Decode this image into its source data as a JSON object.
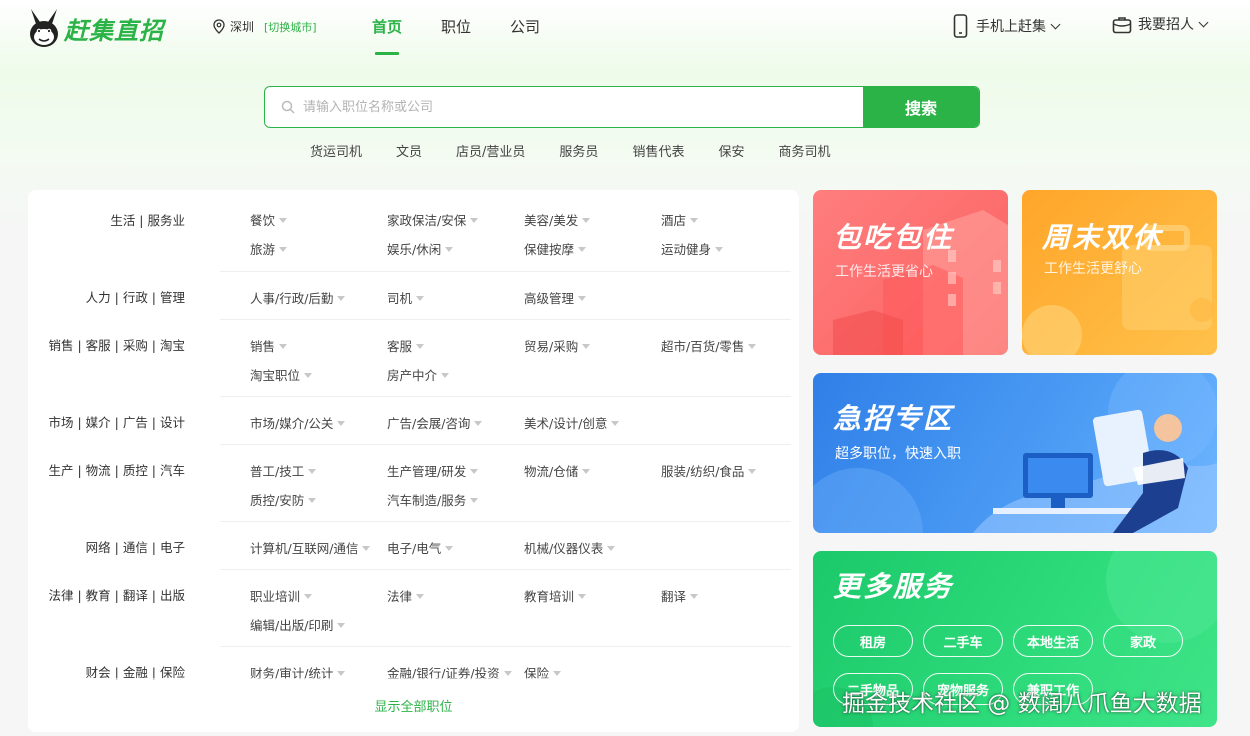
{
  "header": {
    "logo_text": "赶集直招",
    "city": "深圳",
    "switch_city": "[切换城市]",
    "nav": [
      {
        "label": "首页",
        "active": true
      },
      {
        "label": "职位",
        "active": false
      },
      {
        "label": "公司",
        "active": false
      }
    ],
    "mobile_label": "手机上赶集",
    "recruit_label": "我要招人"
  },
  "search": {
    "placeholder": "请输入职位名称或公司",
    "button_label": "搜索",
    "hot_keywords": [
      "货运司机",
      "文员",
      "店员/营业员",
      "服务员",
      "销售代表",
      "保安",
      "商务司机"
    ]
  },
  "categories": [
    {
      "name": "生活 | 服务业",
      "items": [
        "餐饮",
        "家政保洁/安保",
        "美容/美发",
        "酒店",
        "旅游",
        "娱乐/休闲",
        "保健按摩",
        "运动健身"
      ]
    },
    {
      "name": "人力 | 行政 | 管理",
      "items": [
        "人事/行政/后勤",
        "司机",
        "高级管理"
      ]
    },
    {
      "name": "销售 | 客服 | 采购 | 淘宝",
      "items": [
        "销售",
        "客服",
        "贸易/采购",
        "超市/百货/零售",
        "淘宝职位",
        "房产中介"
      ]
    },
    {
      "name": "市场 | 媒介 | 广告 | 设计",
      "items": [
        "市场/媒介/公关",
        "广告/会展/咨询",
        "美术/设计/创意"
      ]
    },
    {
      "name": "生产 | 物流 | 质控 | 汽车",
      "items": [
        "普工/技工",
        "生产管理/研发",
        "物流/仓储",
        "服装/纺织/食品",
        "质控/安防",
        "汽车制造/服务"
      ]
    },
    {
      "name": "网络 | 通信 | 电子",
      "items": [
        "计算机/互联网/通信",
        "电子/电气",
        "机械/仪器仪表"
      ]
    },
    {
      "name": "法律 | 教育 | 翻译 | 出版",
      "items": [
        "职业培训",
        "法律",
        "教育培训",
        "翻译",
        "编辑/出版/印刷"
      ]
    },
    {
      "name": "财会 | 金融 | 保险",
      "items": [
        "财务/审计/统计",
        "金融/银行/证券/投资",
        "保险"
      ]
    }
  ],
  "show_all_label": "显示全部职位",
  "banners": {
    "board_lodging": {
      "title": "包吃包住",
      "subtitle": "工作生活更省心"
    },
    "weekend_off": {
      "title": "周末双休",
      "subtitle": "工作生活更舒心"
    },
    "urgent": {
      "title": "急招专区",
      "subtitle": "超多职位，快速入职"
    },
    "services": {
      "title": "更多服务",
      "buttons": [
        "租房",
        "二手车",
        "本地生活",
        "家政",
        "二手物品",
        "宠物服务",
        "兼职工作"
      ]
    }
  },
  "watermark": "掘金技术社区 @ 数阔八爪鱼大数据",
  "colors": {
    "brand_green": "#2cb348",
    "red_card": "#fb6b6b",
    "orange_card": "#ffb12b",
    "blue_card": "#3d8df0",
    "green_card": "#1fcf72"
  }
}
